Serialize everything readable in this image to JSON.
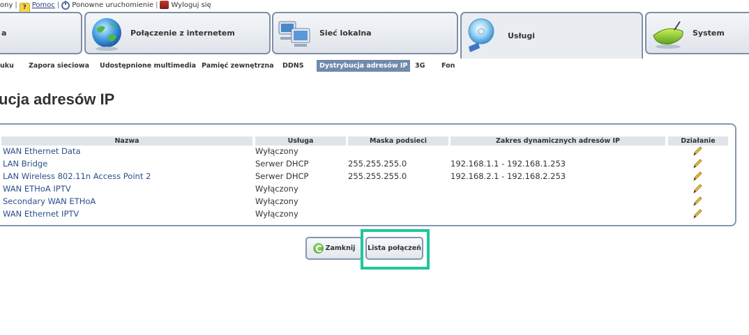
{
  "toplinks": {
    "partial": "ony",
    "help": "Pomoc",
    "restart": "Ponowne uruchomienie",
    "logout": "Wyloguj się"
  },
  "tabs": [
    {
      "label": "a",
      "icon": "home-icon"
    },
    {
      "label": "Połączenie z internetem",
      "icon": "globe-icon"
    },
    {
      "label": "Sieć lokalna",
      "icon": "computers-icon"
    },
    {
      "label": "Usługi",
      "icon": "disc-icon",
      "active": true
    },
    {
      "label": "System",
      "icon": "router-icon"
    }
  ],
  "subnav": {
    "items": [
      "uku",
      "Zapora sieciowa",
      "Udostępnione multimedia",
      "Pamięć zewnętrzna",
      "DDNS",
      "Dystrybucja adresów IP",
      "3G",
      "Fon"
    ],
    "active": "Dystrybucja adresów IP"
  },
  "page_title": "ucja adresów IP",
  "table": {
    "headers": [
      "Nazwa",
      "Usługa",
      "Maska podsieci",
      "Zakres dynamicznych adresów IP",
      "Działanie"
    ],
    "rows": [
      {
        "name": "WAN Ethernet Data",
        "service": "Wyłączony",
        "mask": "",
        "range": ""
      },
      {
        "name": "LAN Bridge",
        "service": "Serwer DHCP",
        "mask": "255.255.255.0",
        "range": "192.168.1.1 - 192.168.1.253"
      },
      {
        "name": "LAN Wireless 802.11n Access Point 2",
        "service": "Serwer DHCP",
        "mask": "255.255.255.0",
        "range": "192.168.2.1 - 192.168.2.253"
      },
      {
        "name": "WAN ETHoA IPTV",
        "service": "Wyłączony",
        "mask": "",
        "range": ""
      },
      {
        "name": "Secondary WAN ETHoA",
        "service": "Wyłączony",
        "mask": "",
        "range": ""
      },
      {
        "name": "WAN Ethernet IPTV",
        "service": "Wyłączony",
        "mask": "",
        "range": ""
      }
    ],
    "action_icon": "pencil-icon"
  },
  "buttons": {
    "close": "Zamknij",
    "connections": "Lista połączeń"
  },
  "colors": {
    "accent": "#6f8aac",
    "link": "#2c4f8c",
    "border": "#8496b0",
    "highlight": "#1fc79b"
  }
}
